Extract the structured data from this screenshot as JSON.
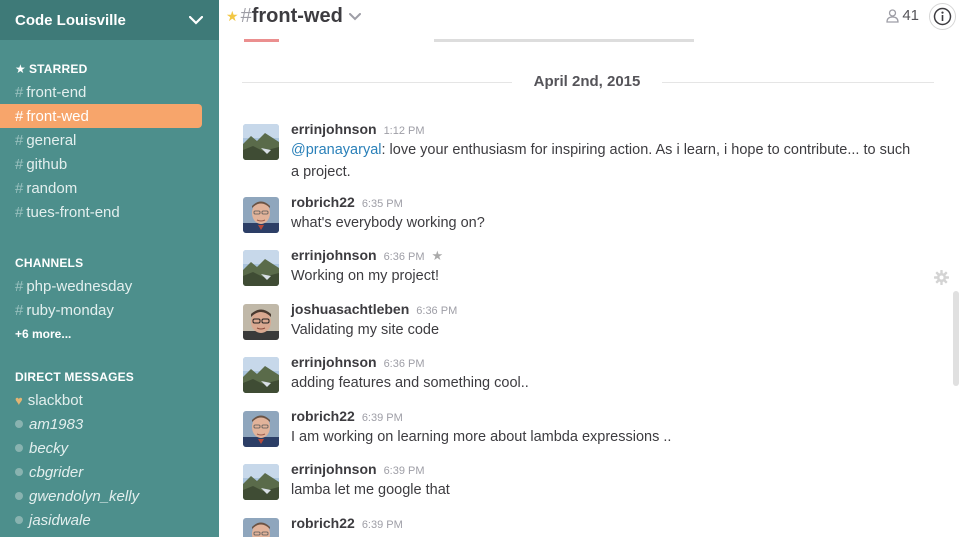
{
  "team": {
    "name": "Code Louisville"
  },
  "sidebar": {
    "starred_title": "STARRED",
    "starred": [
      {
        "label": "front-end"
      },
      {
        "label": "front-wed",
        "active": true
      },
      {
        "label": "general"
      },
      {
        "label": "github"
      },
      {
        "label": "random"
      },
      {
        "label": "tues-front-end"
      }
    ],
    "channels_title": "CHANNELS",
    "channels": [
      {
        "label": "php-wednesday"
      },
      {
        "label": "ruby-monday"
      }
    ],
    "channels_more": "+6 more...",
    "dm_title": "DIRECT MESSAGES",
    "dms": [
      {
        "label": "slackbot"
      },
      {
        "label": "am1983"
      },
      {
        "label": "becky"
      },
      {
        "label": "cbgrider"
      },
      {
        "label": "gwendolyn_kelly"
      },
      {
        "label": "jasidwale"
      }
    ],
    "hash": "#",
    "colors": {
      "background": "#4d8f8c",
      "header": "#3e7a78",
      "active": "#f7a56b"
    }
  },
  "header": {
    "channel_hash": "#",
    "channel_name": "front-wed",
    "member_count": "41"
  },
  "messages": {
    "day_divider": "April 2nd, 2015",
    "items": [
      {
        "author": "errinjohnson",
        "time": "1:12 PM",
        "mention": "@pranayaryal",
        "text": ": love your enthusiasm for inspiring action.  As i learn, i hope to contribute... to such a project.",
        "avatar": "landscape"
      },
      {
        "author": "robrich22",
        "time": "6:35 PM",
        "text": "what's everybody working on?",
        "avatar": "robrich"
      },
      {
        "author": "errinjohnson",
        "time": "6:36 PM",
        "text": "Working on my project!",
        "avatar": "landscape",
        "starred": true
      },
      {
        "author": "joshuasachtleben",
        "time": "6:36 PM",
        "text": "Validating my site code",
        "avatar": "joshua"
      },
      {
        "author": "errinjohnson",
        "time": "6:36 PM",
        "text": "adding features and something cool..",
        "avatar": "landscape"
      },
      {
        "author": "robrich22",
        "time": "6:39 PM",
        "text": "I am working on learning more about lambda expressions ..",
        "avatar": "robrich"
      },
      {
        "author": "errinjohnson",
        "time": "6:39 PM",
        "text": "lamba let me google that",
        "avatar": "landscape"
      },
      {
        "author": "robrich22",
        "time": "6:39 PM",
        "text": "",
        "avatar": "robrich"
      }
    ]
  },
  "icons": {
    "star": "star-icon",
    "info": "info-icon",
    "member": "person-icon",
    "gear": "gear-icon",
    "chevron": "chevron-down-icon"
  }
}
